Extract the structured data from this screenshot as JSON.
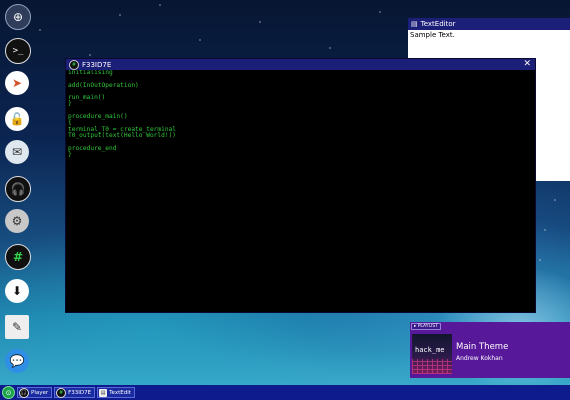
{
  "desktop": {
    "icons": [
      {
        "name": "system",
        "glyph": "⊕",
        "color": "#2f3d5a"
      },
      {
        "name": "terminal",
        "glyph": ">_",
        "color": "#111111"
      },
      {
        "name": "browser",
        "glyph": "➤",
        "color": "#ffffff"
      },
      {
        "name": "lock",
        "glyph": "🔓",
        "color": "#ffffff"
      },
      {
        "name": "messages",
        "glyph": "✉",
        "color": "#dfe7ef"
      },
      {
        "name": "player",
        "glyph": "🎧",
        "color": "#101010"
      },
      {
        "name": "tools",
        "glyph": "⚙",
        "color": "#c8c8c8"
      },
      {
        "name": "hash",
        "glyph": "#",
        "color": "#101010"
      },
      {
        "name": "download",
        "glyph": "⬇",
        "color": "#ffffff"
      },
      {
        "name": "texteditor",
        "glyph": "✎",
        "color": "#eeeeee"
      },
      {
        "name": "chat",
        "glyph": "💬",
        "color": "#2f8fe6"
      }
    ]
  },
  "texteditor": {
    "title": "TextEditor",
    "content": "Sample Text."
  },
  "terminal": {
    "title": "F33ID7E",
    "close": "✕",
    "code": "initialising\n\nadd(InOutOperation)\n\nrun_main()\n}\n\nprocedure_main()\n{\nterminal_T0 = create_terminal\nT0_output(text(Hello World!))\n\nprocedure_end\n}"
  },
  "music": {
    "tag": "▸ PLAYLIST",
    "art_text": "hack_me",
    "title": "Main Theme",
    "artist": "Andrew Kokhan"
  },
  "taskbar": {
    "items": [
      {
        "label": "Player"
      },
      {
        "label": "F33ID7E"
      },
      {
        "label": "TextEdit"
      }
    ]
  }
}
